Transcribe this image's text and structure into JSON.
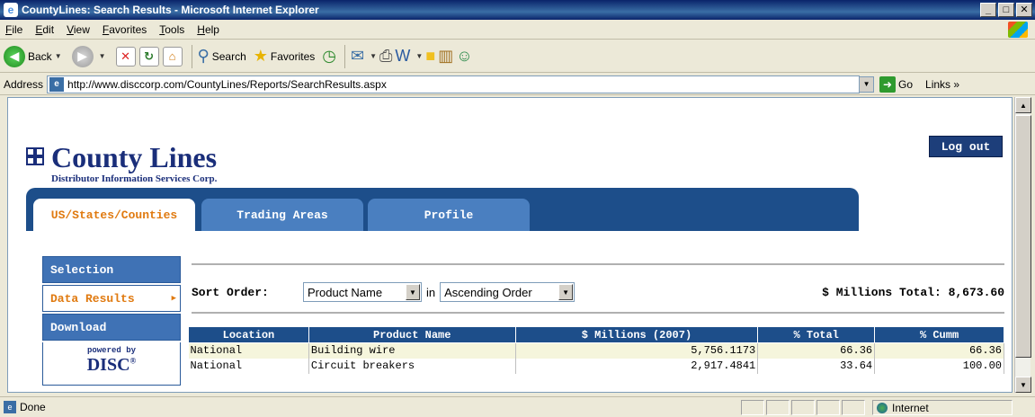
{
  "window": {
    "title": "CountyLines: Search Results - Microsoft Internet Explorer",
    "min": "_",
    "max": "□",
    "close": "✕"
  },
  "menu": [
    "File",
    "Edit",
    "View",
    "Favorites",
    "Tools",
    "Help"
  ],
  "toolbar": {
    "back": "Back",
    "search": "Search",
    "favorites": "Favorites"
  },
  "address": {
    "label": "Address",
    "url": "http://www.disccorp.com/CountyLines/Reports/SearchResults.aspx",
    "go": "Go",
    "links": "Links »"
  },
  "site": {
    "logo": "County Lines",
    "logo_sub": "Distributor Information Services Corp.",
    "logout": "Log out"
  },
  "tabs": [
    {
      "label": "US/States/Counties",
      "active": true
    },
    {
      "label": "Trading Areas",
      "active": false
    },
    {
      "label": "Profile",
      "active": false
    }
  ],
  "sidenav": [
    {
      "label": "Selection",
      "active": false
    },
    {
      "label": "Data Results",
      "active": true
    },
    {
      "label": "Download",
      "active": false
    }
  ],
  "powered": {
    "by": "powered by",
    "brand": "DISC",
    "reg": "®"
  },
  "sort": {
    "label": "Sort Order:",
    "field": "Product Name",
    "in": "in",
    "order": "Ascending Order",
    "total": "$ Millions Total: 8,673.60"
  },
  "table": {
    "headers": [
      "Location",
      "Product Name",
      "$ Millions (2007)",
      "% Total",
      "% Cumm"
    ],
    "rows": [
      [
        "National",
        "Building wire",
        "5,756.1173",
        "66.36",
        "66.36"
      ],
      [
        "National",
        "Circuit breakers",
        "2,917.4841",
        "33.64",
        "100.00"
      ]
    ]
  },
  "status": {
    "text": "Done",
    "zone": "Internet"
  }
}
